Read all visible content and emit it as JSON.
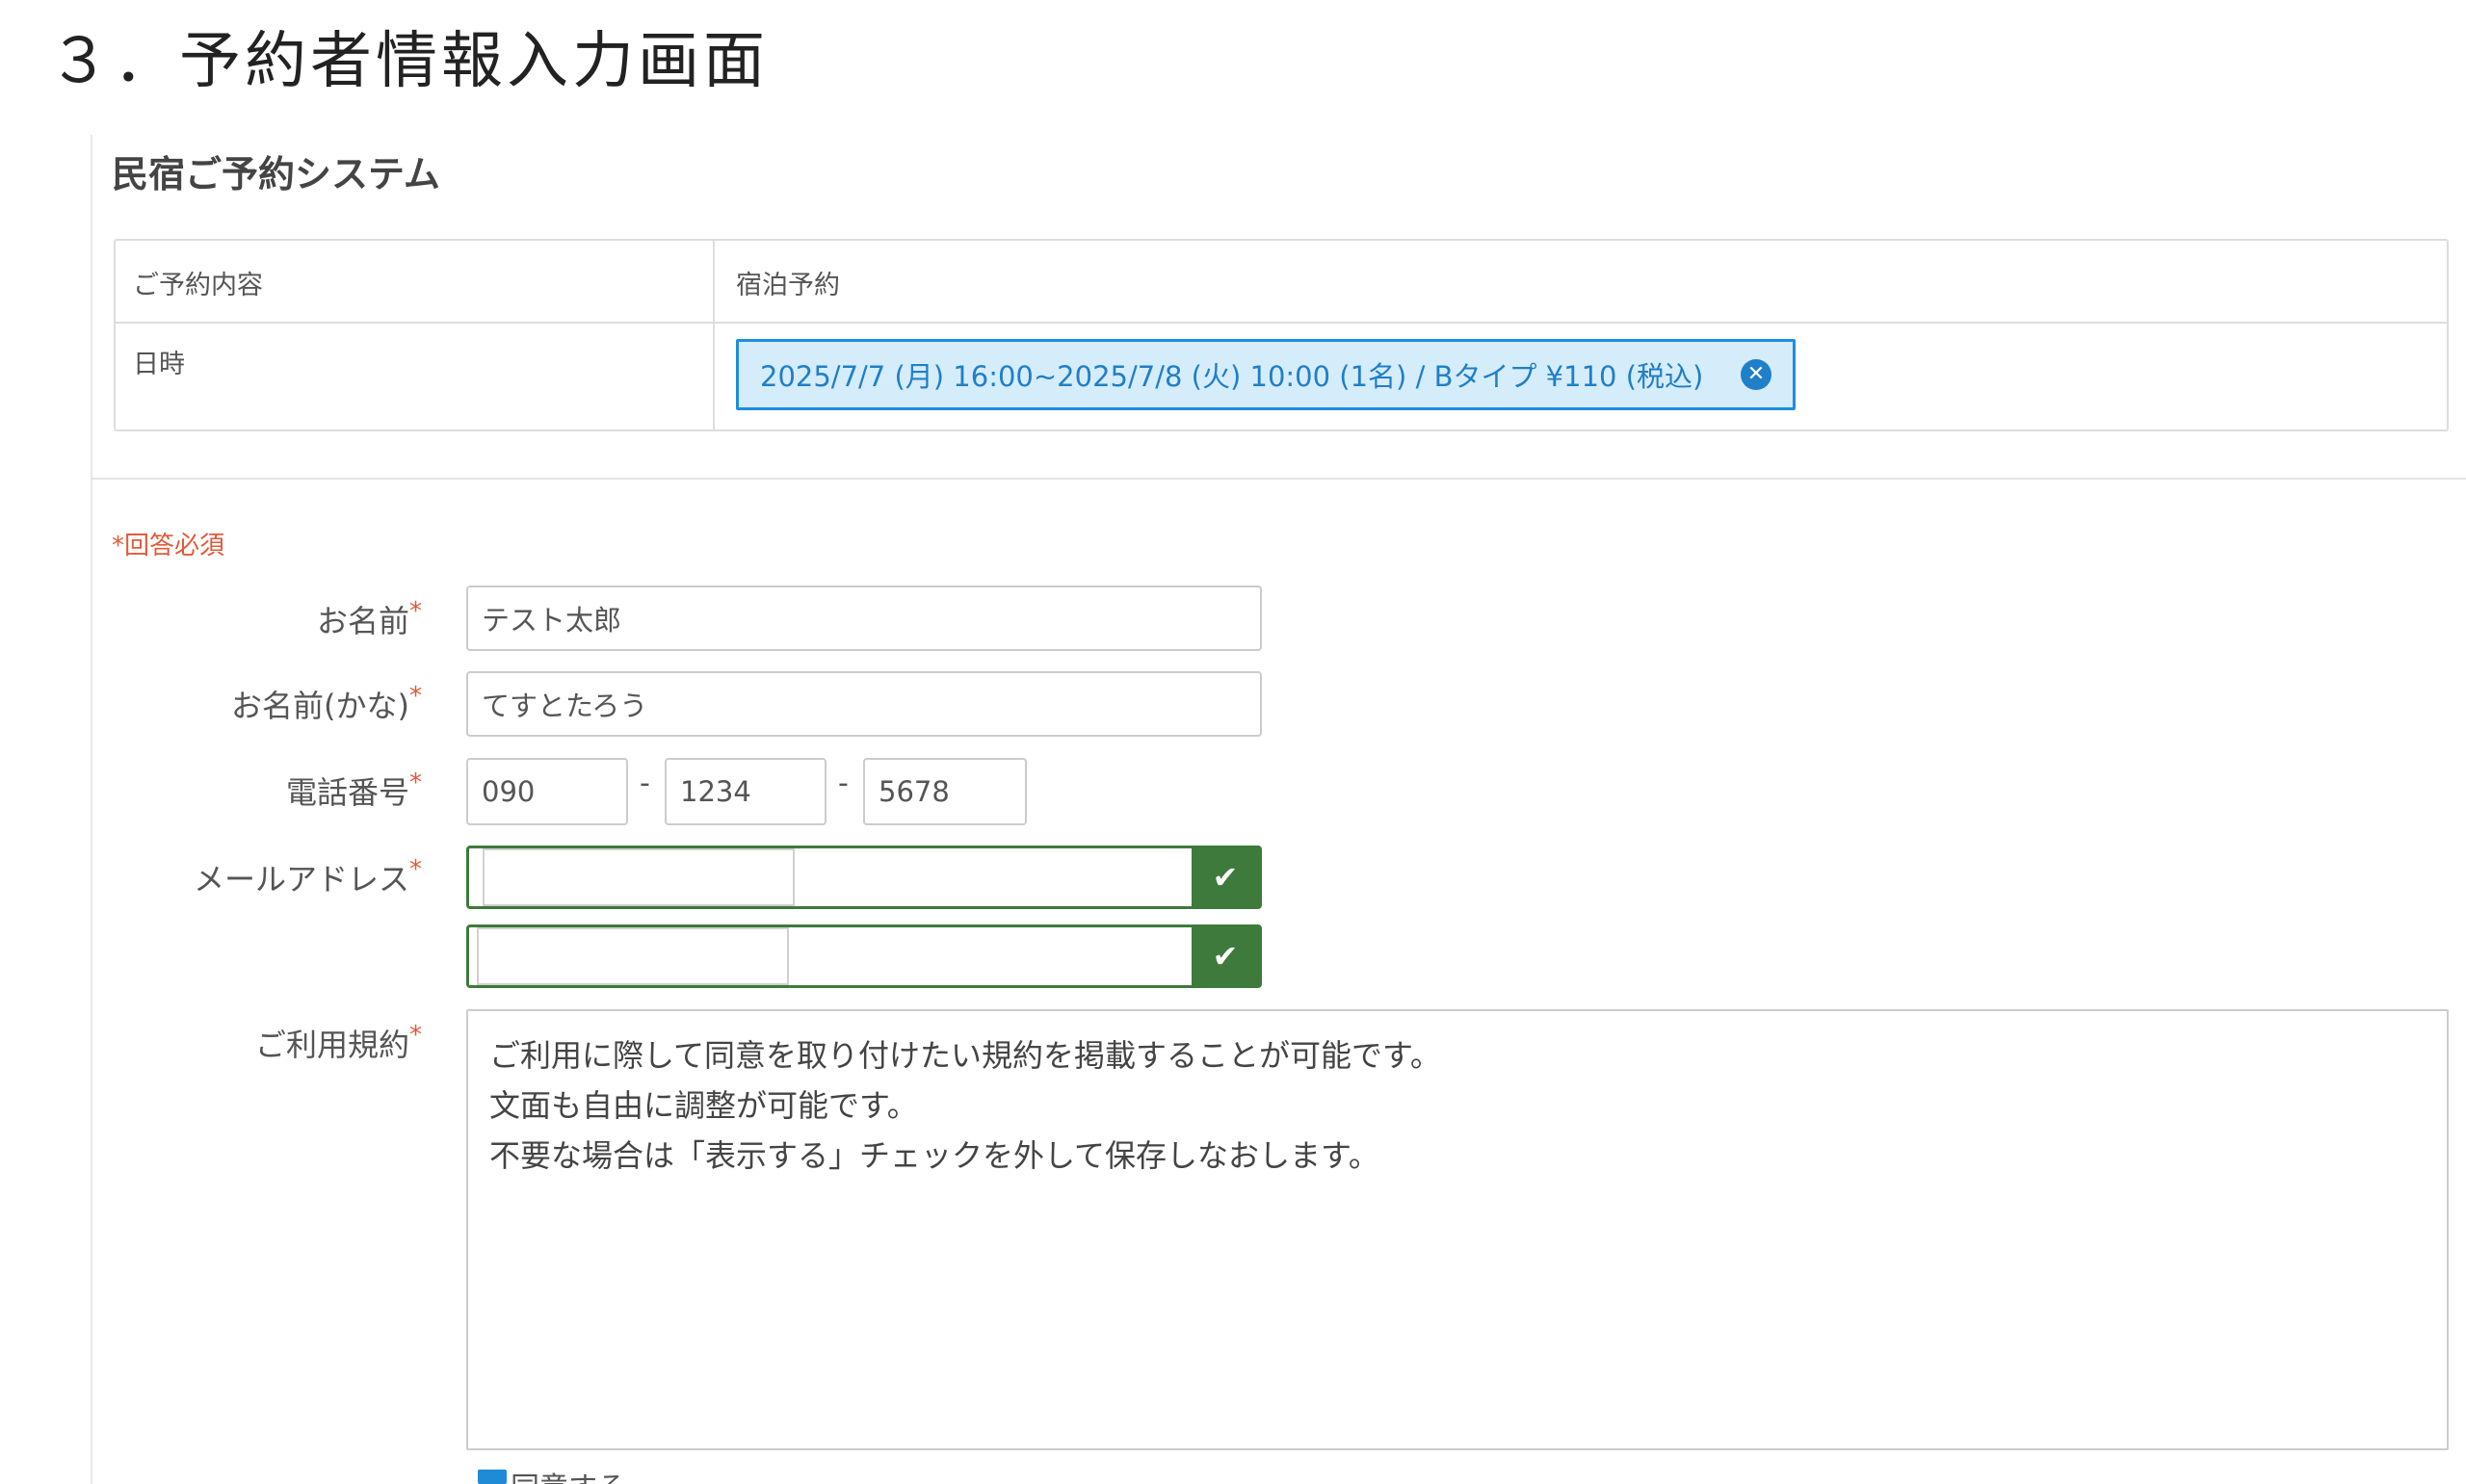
{
  "doc_title": "３．予約者情報入力画面",
  "system_title": "民宿ご予約システム",
  "summary": {
    "content_label": "ご予約内容",
    "content_value": "宿泊予約",
    "datetime_label": "日時",
    "selection": "2025/7/7 (月) 16:00~2025/7/8 (火) 10:00 (1名) / Bタイプ ¥110 (税込)",
    "close_glyph": "✕"
  },
  "form": {
    "required_note": "*回答必須",
    "required_mark": "*",
    "name_label": "お名前",
    "name_value": "テスト太郎",
    "kana_label": "お名前(かな)",
    "kana_value": "てすとたろう",
    "phone_label": "電話番号",
    "phone": [
      "090",
      "1234",
      "5678"
    ],
    "phone_sep": "-",
    "email_label": "メールアドレス",
    "email_value": "",
    "email_confirm_value": "",
    "check_glyph": "✔",
    "terms_label": "ご利用規約",
    "terms_lines": [
      "ご利用に際して同意を取り付けたい規約を掲載することが可能です。",
      "文面も自由に調整が可能です。",
      "不要な場合は「表示する」チェックを外して保存しなおします。"
    ],
    "agree_label": "同意する"
  },
  "colors": {
    "accent_blue": "#1e8de0",
    "chip_bg": "#d5ecfb",
    "valid_green": "#3d7a3b",
    "required_red": "#e05a3a"
  }
}
